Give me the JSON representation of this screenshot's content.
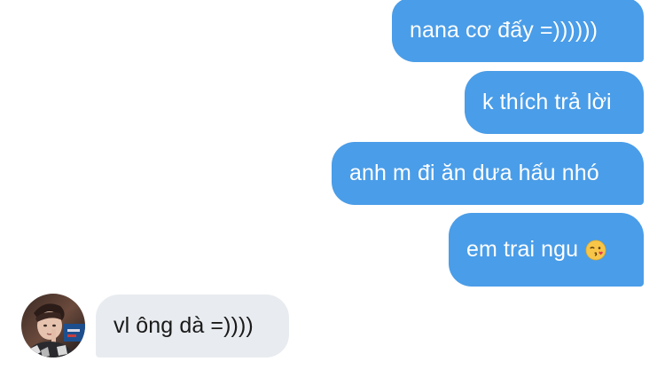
{
  "conversation": {
    "messages": [
      {
        "direction": "outgoing",
        "text": "nana cơ đấy =))))))"
      },
      {
        "direction": "outgoing",
        "text": "k thích trả lời"
      },
      {
        "direction": "outgoing",
        "text": "anh m đi ăn dưa hấu nhó"
      },
      {
        "direction": "outgoing",
        "text": "em trai ngu",
        "emoji": "face-blowing-a-kiss-emoji"
      },
      {
        "direction": "incoming",
        "text": "vl ông dà =))))",
        "avatar": "contact-avatar"
      }
    ]
  },
  "colors": {
    "outgoing_bubble": "#4a9de8",
    "outgoing_text": "#ffffff",
    "incoming_bubble": "#e8ebef",
    "incoming_text": "#1a1a1a"
  }
}
